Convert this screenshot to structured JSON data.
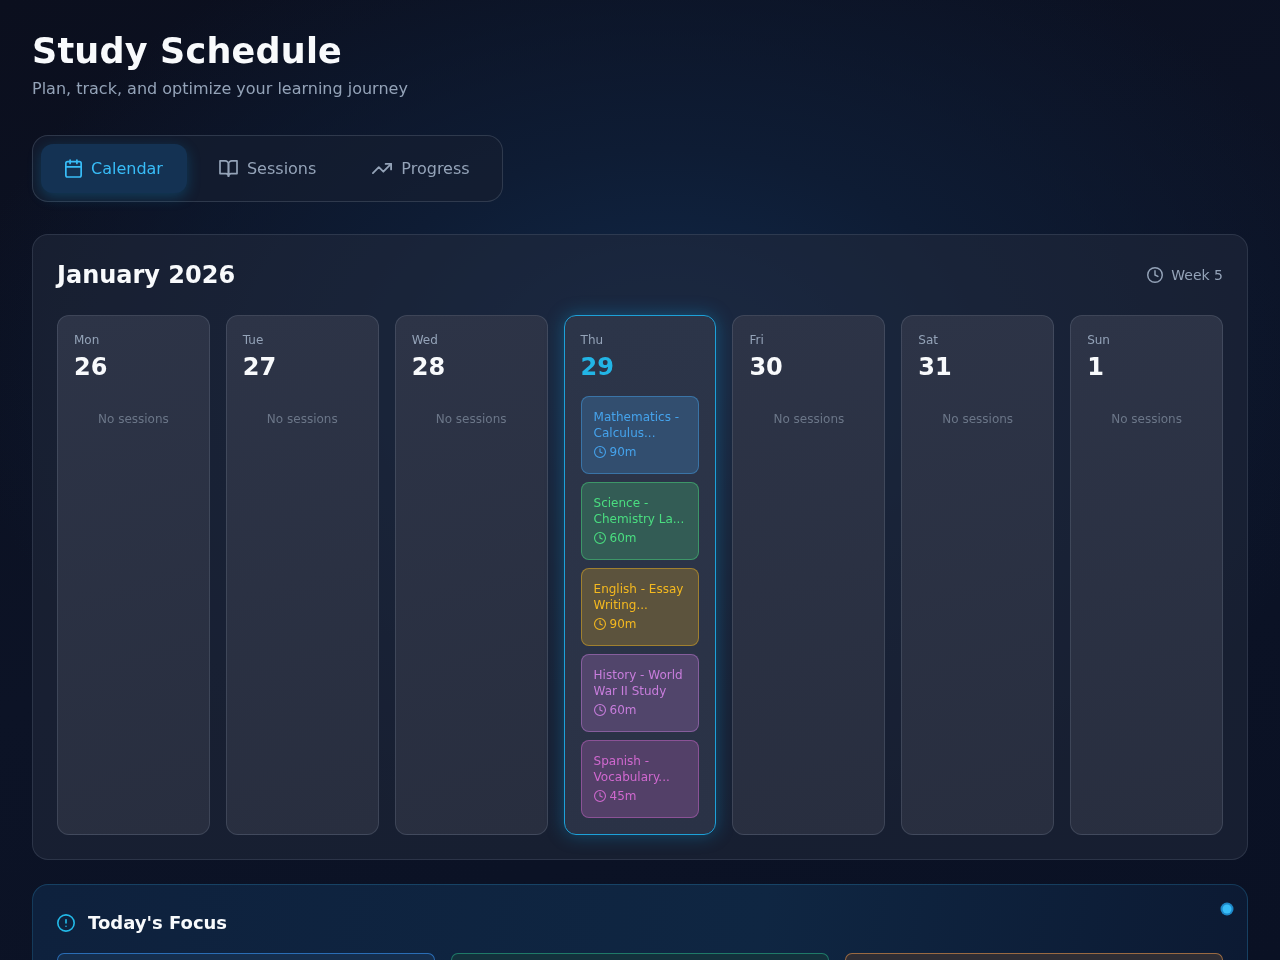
{
  "header": {
    "title": "Study Schedule",
    "subtitle": "Plan, track, and optimize your learning journey"
  },
  "tabs": [
    {
      "label": "Calendar",
      "selected": true
    },
    {
      "label": "Sessions",
      "selected": false
    },
    {
      "label": "Progress",
      "selected": false
    }
  ],
  "calendar": {
    "title": "January 2026",
    "week": "Week 5",
    "days": [
      {
        "name": "Mon",
        "date": "26",
        "selected": false,
        "empty_text": "No sessions"
      },
      {
        "name": "Tue",
        "date": "27",
        "selected": false,
        "empty_text": "No sessions"
      },
      {
        "name": "Wed",
        "date": "28",
        "selected": false,
        "empty_text": "No sessions"
      },
      {
        "name": "Thu",
        "date": "29",
        "selected": true,
        "sessions": [
          {
            "title": "Mathematics - Calculus...",
            "duration": "90m",
            "color": "#45a3ec"
          },
          {
            "title": "Science - Chemistry La...",
            "duration": "60m",
            "color": "#4ade80"
          },
          {
            "title": "English - Essay Writing...",
            "duration": "90m",
            "color": "#f5b91f"
          },
          {
            "title": "History - World War II Study",
            "duration": "60m",
            "color": "#c87ddc"
          },
          {
            "title": "Spanish - Vocabulary...",
            "duration": "45m",
            "color": "#d068cf"
          }
        ]
      },
      {
        "name": "Fri",
        "date": "30",
        "selected": false,
        "empty_text": "No sessions"
      },
      {
        "name": "Sat",
        "date": "31",
        "selected": false,
        "empty_text": "No sessions"
      },
      {
        "name": "Sun",
        "date": "1",
        "selected": false,
        "empty_text": "No sessions"
      }
    ]
  },
  "focus": {
    "title": "Today's Focus",
    "cards": [
      {
        "color": "#2a6db5"
      },
      {
        "color": "#1f7a68"
      },
      {
        "color": "#9a6a42"
      }
    ]
  }
}
